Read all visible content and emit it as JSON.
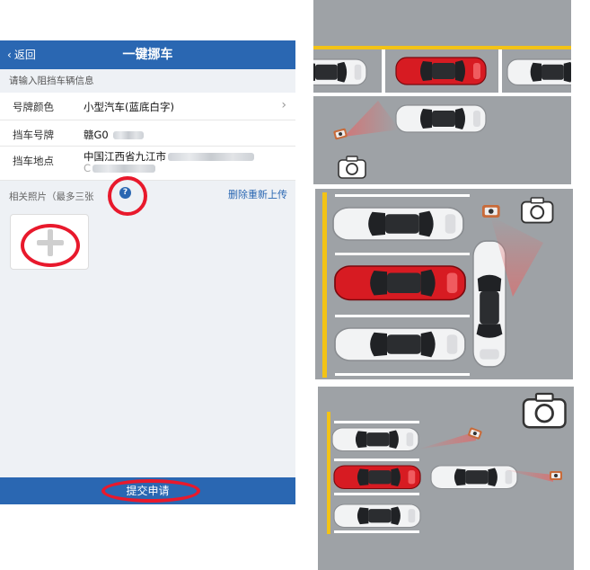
{
  "nav": {
    "back_label": "返回",
    "title": "一键挪车"
  },
  "form": {
    "prompt": "请输入阻挡车辆信息",
    "plate_color": {
      "label": "号牌颜色",
      "value": "小型汽车(蓝底白字)"
    },
    "plate_number": {
      "label": "挡车号牌",
      "value": "赣G0"
    },
    "location": {
      "label": "挡车地点",
      "value": "中国江西省九江市",
      "value_line2": "C"
    }
  },
  "photos": {
    "label": "相关照片（最多三张",
    "help_glyph": "?",
    "delete_label": "删除重新上传"
  },
  "submit_label": "提交申请",
  "colors": {
    "brand_blue": "#2a67b2",
    "annotation_red": "#e8192c",
    "road_gray": "#9a9ea3",
    "line_yellow": "#f3c316"
  },
  "icons": [
    "chevron-left-icon",
    "chevron-right-icon",
    "help-icon",
    "plus-icon",
    "camera-icon"
  ]
}
